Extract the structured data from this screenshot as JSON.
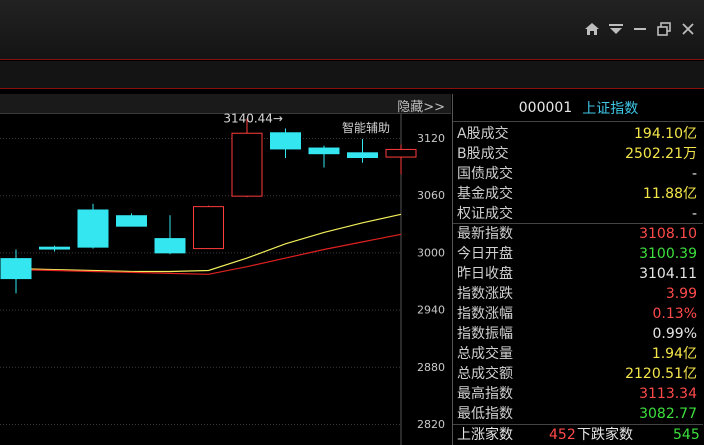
{
  "window_controls": [
    "home-icon",
    "dropdown-icon",
    "minimize-icon",
    "restore-icon",
    "close-icon"
  ],
  "chart": {
    "hide_label": "隐藏>>",
    "assist_label": "智能辅助",
    "high_annotation": "3140.44→"
  },
  "chart_data": {
    "type": "candlestick",
    "y_ticks": [
      "3120",
      "3060",
      "3000",
      "2940",
      "2880",
      "2820"
    ],
    "ylim": [
      2820,
      3150
    ],
    "candles": [
      {
        "open": 2994,
        "high": 3003,
        "low": 2957,
        "close": 2972
      },
      {
        "open": 3006,
        "high": 3007,
        "low": 3001,
        "close": 3003
      },
      {
        "open": 3045,
        "high": 3051,
        "low": 3004,
        "close": 3005
      },
      {
        "open": 3039,
        "high": 3041,
        "low": 3028,
        "close": 3027
      },
      {
        "open": 3015,
        "high": 3039,
        "low": 2998,
        "close": 2999
      },
      {
        "open": 3004,
        "high": 3049,
        "low": 3004,
        "close": 3048
      },
      {
        "open": 3059,
        "high": 3140.44,
        "low": 3058,
        "close": 3125
      },
      {
        "open": 3126,
        "high": 3130,
        "low": 3099,
        "close": 3108
      },
      {
        "open": 3110,
        "high": 3112,
        "low": 3089,
        "close": 3103
      },
      {
        "open": 3105,
        "high": 3119,
        "low": 3094,
        "close": 3099
      },
      {
        "open": 3100,
        "high": 3113,
        "low": 3082,
        "close": 3108
      }
    ],
    "ma_yellow": [
      2983,
      2982,
      2981,
      2980,
      2980,
      2981,
      2994,
      3009,
      3021,
      3031,
      3040
    ],
    "ma_red": [
      2982,
      2981,
      2980,
      2979,
      2978,
      2977,
      2985,
      2994,
      3003,
      3011,
      3019
    ],
    "colors": {
      "up": "#ff3c3c",
      "down": "#33e6f0",
      "ma_yellow": "#f2ee5c",
      "ma_red": "#e02020",
      "grid": "#3a3a3a"
    }
  },
  "quote": {
    "code": "000001",
    "name": "上证指数",
    "rows": [
      {
        "label": "A股成交",
        "value": "194.10亿",
        "color": "c-yel"
      },
      {
        "label": "B股成交",
        "value": "2502.21万",
        "color": "c-yel"
      },
      {
        "label": "国债成交",
        "value": "-",
        "color": "c-wht"
      },
      {
        "label": "基金成交",
        "value": "11.88亿",
        "color": "c-yel"
      },
      {
        "label": "权证成交",
        "value": "-",
        "color": "c-wht"
      },
      {
        "label": "最新指数",
        "value": "3108.10",
        "color": "c-red"
      },
      {
        "label": "今日开盘",
        "value": "3100.39",
        "color": "c-grn"
      },
      {
        "label": "昨日收盘",
        "value": "3104.11",
        "color": "c-wht"
      },
      {
        "label": "指数涨跌",
        "value": "3.99",
        "color": "c-red"
      },
      {
        "label": "指数涨幅",
        "value": "0.13%",
        "color": "c-red"
      },
      {
        "label": "指数振幅",
        "value": "0.99%",
        "color": "c-wht"
      },
      {
        "label": "总成交量",
        "value": "1.94亿",
        "color": "c-yel"
      },
      {
        "label": "总成交额",
        "value": "2120.51亿",
        "color": "c-yel"
      },
      {
        "label": "最高指数",
        "value": "3113.34",
        "color": "c-red"
      },
      {
        "label": "最低指数",
        "value": "3082.77",
        "color": "c-grn"
      }
    ],
    "updown": {
      "up_label": "上涨家数",
      "up_value": "452",
      "down_label": "下跌家数",
      "down_value": "545"
    }
  }
}
